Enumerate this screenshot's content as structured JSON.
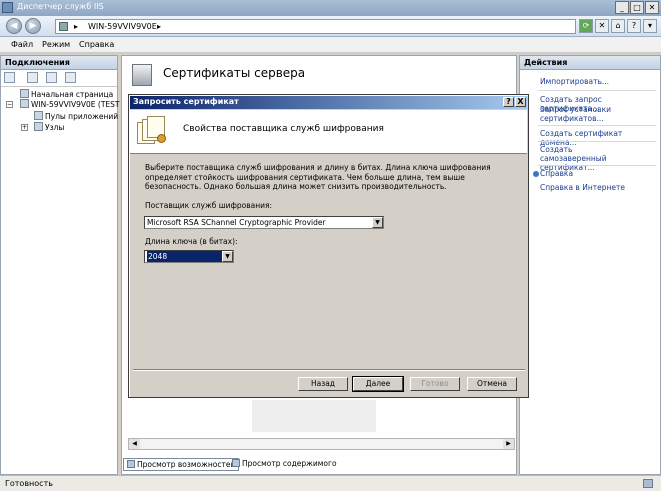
{
  "window": {
    "title": "Диспетчер служб IIS",
    "controls": [
      "_",
      "□",
      "✕"
    ]
  },
  "address": {
    "crumb": "WIN-59VVIV9V0E",
    "sep1": "▸",
    "sep2": "▸"
  },
  "menu": {
    "items": [
      "Файл",
      "Режим",
      "Справка"
    ]
  },
  "connections": {
    "header": "Подключения",
    "tree": {
      "start_page": "Начальная страница",
      "server": "WIN-59VVIV9V0E (TEST",
      "app_pools": "Пулы приложений",
      "sites": "Узлы"
    }
  },
  "center": {
    "heading": "Сертификаты сервера",
    "bottom_tabs": [
      "Просмотр возможностей",
      "Просмотр содержимого"
    ]
  },
  "actions": {
    "header": "Действия",
    "items": [
      "Импортировать...",
      "Создать запрос сертификата...",
      "Запрос установки сертификатов...",
      "Создать сертификат домена...",
      "Создать самозаверенный сертификат...",
      "Справка",
      "Справка в Интернете"
    ]
  },
  "status": {
    "text": "Готовность"
  },
  "dialog": {
    "title": "Запросить сертификат",
    "title_buttons": [
      "?",
      "X"
    ],
    "header_title": "Свойства поставщика служб шифрования",
    "description": "Выберите поставщика служб шифрования и длину в битах. Длина ключа шифрования определяет стойкость шифрования сертификата. Чем больше длина, тем выше безопасность. Однако большая длина может снизить производительность.",
    "provider_label": "Поставщик служб шифрования:",
    "provider_value": "Microsoft RSA SChannel Cryptographic Provider",
    "key_length_label": "Длина ключа (в битах):",
    "key_length_value": "2048",
    "buttons": {
      "back": "Назад",
      "next": "Далее",
      "finish": "Готово",
      "cancel": "Отмена"
    }
  },
  "colors": {
    "title_gradient_start": "#0a246a",
    "title_gradient_end": "#a6caf0",
    "link": "#1a3e8f"
  }
}
